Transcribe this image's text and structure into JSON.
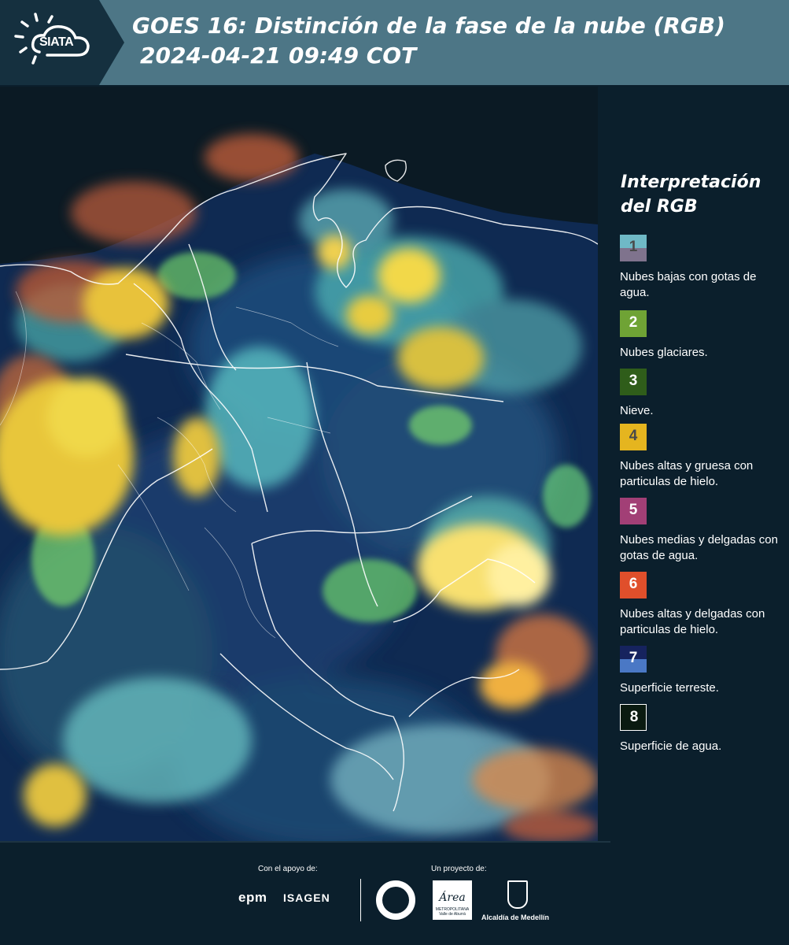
{
  "header": {
    "logo_text": "SIATA",
    "title_line1": "GOES 16: Distinción de la fase de la nube (RGB)",
    "title_line2": "2024-04-21 09:49 COT",
    "background_color": "#4d7686"
  },
  "legend": {
    "title": "Interpretación del RGB",
    "items": [
      {
        "number": "1",
        "text": "Nubes bajas con gotas de agua.",
        "color_top": "#6fb9c6",
        "color_bottom": "#7f738d",
        "number_color": "#4a4a4a"
      },
      {
        "number": "2",
        "text": "Nubes glaciares.",
        "color_top": "#6fa335",
        "color_bottom": "#6fa335",
        "number_color": "#ffffff"
      },
      {
        "number": "3",
        "text": "Nieve.",
        "color_top": "#2f5d1a",
        "color_bottom": "#2f5d1a",
        "number_color": "#ffffff"
      },
      {
        "number": "4",
        "text": "Nubes altas y gruesa con particulas de hielo.",
        "color_top": "#e5b51f",
        "color_bottom": "#e5b51f",
        "number_color": "#4a4a4a"
      },
      {
        "number": "5",
        "text": "Nubes medias y delgadas con gotas de agua.",
        "color_top": "#a23f76",
        "color_bottom": "#a23f76",
        "number_color": "#ffffff"
      },
      {
        "number": "6",
        "text": "Nubes altas y delgadas con particulas de hielo.",
        "color_top": "#e04f2b",
        "color_bottom": "#e04f2b",
        "number_color": "#ffffff"
      },
      {
        "number": "7",
        "text": "Superficie terreste.",
        "color_top": "#16235e",
        "color_bottom": "#4a78c5",
        "number_color": "#ffffff"
      },
      {
        "number": "8",
        "text": "Superficie de agua.",
        "color_top": "#0a1a10",
        "color_bottom": "#0a1a10",
        "number_color": "#ffffff"
      }
    ]
  },
  "footer": {
    "support_label": "Con el apoyo de:",
    "project_label": "Un proyecto de:",
    "epm_text": "epm",
    "isagen_text": "ISAGEN",
    "area_text": "Área",
    "area_subtext": "METROPOLITANA Valle de Aburrá",
    "medellin_text": "Alcaldía de Medellín"
  },
  "colors": {
    "page_background": "#0b1f2c",
    "map_land": "#1b3a6b",
    "map_ocean": "#0a1620",
    "cloud_yellow": "#f2d23a",
    "cloud_cyan": "#5fc8c8",
    "cloud_orange": "#d8683a"
  }
}
